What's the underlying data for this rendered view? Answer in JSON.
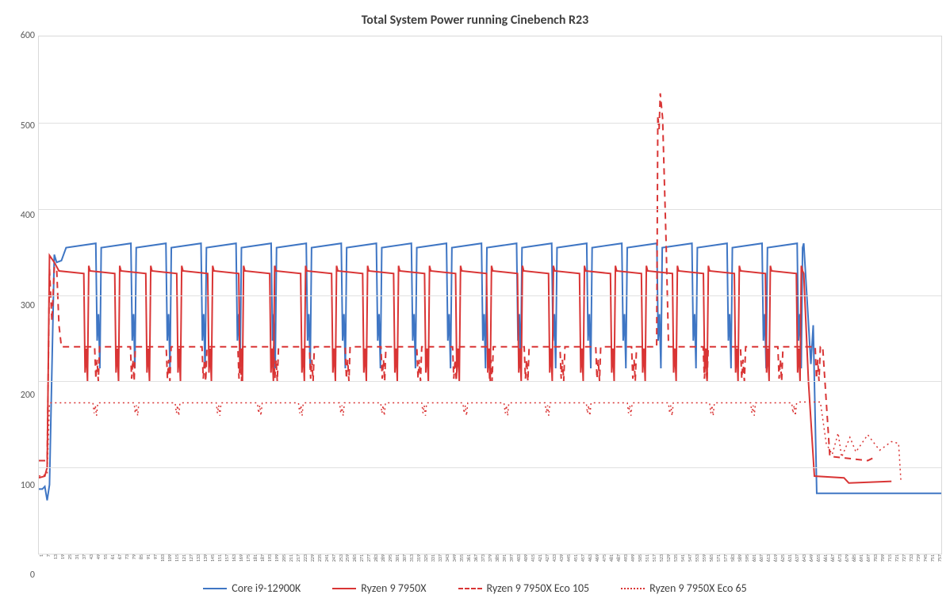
{
  "chart_data": {
    "type": "line",
    "title": "Total System Power running Cinebench R23",
    "xlabel": "",
    "ylabel": "",
    "ylim": [
      0,
      600
    ],
    "yticks": [
      0,
      100,
      200,
      300,
      400,
      500,
      600
    ],
    "x_range": [
      1,
      762
    ],
    "x_tick_step": 6,
    "series": [
      {
        "name": "Core i9-12900K",
        "color": "#3f76c4",
        "dash": "solid",
        "pattern": {
          "startup": [
            {
              "x": 1,
              "y": 75
            },
            {
              "x": 4,
              "y": 75
            },
            {
              "x": 6,
              "y": 78
            },
            {
              "x": 8,
              "y": 62
            },
            {
              "x": 10,
              "y": 80
            },
            {
              "x": 14,
              "y": 347
            },
            {
              "x": 16,
              "y": 338
            },
            {
              "x": 20,
              "y": 340
            }
          ],
          "cycle_start_x": 24,
          "cycle_end_x": 645,
          "cycle_count": 21,
          "cycle_shape": [
            {
              "dx": 0,
              "y": 355
            },
            {
              "dx": 22,
              "y": 360
            },
            {
              "dx": 23,
              "y": 247
            },
            {
              "dx": 24,
              "y": 278
            },
            {
              "dx": 25,
              "y": 215
            },
            {
              "dx": 26,
              "y": 355
            }
          ],
          "tail": [
            {
              "x": 646,
              "y": 360
            },
            {
              "x": 652,
              "y": 220
            },
            {
              "x": 654,
              "y": 265
            },
            {
              "x": 657,
              "y": 70
            },
            {
              "x": 762,
              "y": 70
            }
          ]
        }
      },
      {
        "name": "Ryzen 9 7950X",
        "color": "#d93535",
        "dash": "solid",
        "pattern": {
          "startup": [
            {
              "x": 1,
              "y": 88
            },
            {
              "x": 6,
              "y": 90
            },
            {
              "x": 8,
              "y": 100
            },
            {
              "x": 10,
              "y": 346
            },
            {
              "x": 14,
              "y": 338
            }
          ],
          "cycle_start_x": 18,
          "cycle_end_x": 645,
          "cycle_count": 24,
          "cycle_shape": [
            {
              "dx": 0,
              "y": 328
            },
            {
              "dx": 20,
              "y": 325
            },
            {
              "dx": 21,
              "y": 210
            },
            {
              "dx": 22,
              "y": 238
            },
            {
              "dx": 23,
              "y": 200
            },
            {
              "dx": 24,
              "y": 334
            },
            {
              "dx": 25,
              "y": 328
            }
          ],
          "tail": [
            {
              "x": 646,
              "y": 325
            },
            {
              "x": 650,
              "y": 200
            },
            {
              "x": 655,
              "y": 90
            },
            {
              "x": 680,
              "y": 88
            },
            {
              "x": 684,
              "y": 82
            },
            {
              "x": 720,
              "y": 84
            }
          ]
        }
      },
      {
        "name": "Ryzen 9 7950X Eco 105",
        "color": "#d93535",
        "dash": "dashed",
        "pattern": {
          "startup": [
            {
              "x": 1,
              "y": 108
            },
            {
              "x": 8,
              "y": 108
            },
            {
              "x": 10,
              "y": 330
            },
            {
              "x": 12,
              "y": 270
            },
            {
              "x": 14,
              "y": 332
            },
            {
              "x": 16,
              "y": 332
            },
            {
              "x": 18,
              "y": 265
            },
            {
              "x": 20,
              "y": 240
            }
          ],
          "cycle_start_x": 22,
          "cycle_end_x": 505,
          "cycle_count": 16,
          "cycle_shape": [
            {
              "dx": 0,
              "y": 240
            },
            {
              "dx": 25,
              "y": 240
            },
            {
              "dx": 26,
              "y": 203
            },
            {
              "dx": 27,
              "y": 225
            },
            {
              "dx": 28,
              "y": 200
            },
            {
              "dx": 29,
              "y": 240
            }
          ],
          "spike": [
            {
              "x": 508,
              "y": 240
            },
            {
              "x": 522,
              "y": 240
            },
            {
              "x": 523,
              "y": 508
            },
            {
              "x": 524,
              "y": 492
            },
            {
              "x": 525,
              "y": 534
            },
            {
              "x": 527,
              "y": 505
            },
            {
              "x": 530,
              "y": 360
            },
            {
              "x": 532,
              "y": 240
            }
          ],
          "post_spike_cycle_start_x": 534,
          "post_spike_cycle_end_x": 660,
          "post_spike_cycle_count": 4,
          "tail": [
            {
              "x": 662,
              "y": 240
            },
            {
              "x": 668,
              "y": 113
            },
            {
              "x": 700,
              "y": 108
            },
            {
              "x": 706,
              "y": 112
            }
          ]
        }
      },
      {
        "name": "Ryzen 9 7950X Eco 65",
        "color": "#d93535",
        "dash": "dotted",
        "pattern": {
          "startup": [
            {
              "x": 1,
              "y": 90
            },
            {
              "x": 8,
              "y": 92
            },
            {
              "x": 10,
              "y": 175
            },
            {
              "x": 14,
              "y": 175
            }
          ],
          "cycle_start_x": 16,
          "cycle_end_x": 640,
          "cycle_count": 18,
          "cycle_shape": [
            {
              "dx": 0,
              "y": 175
            },
            {
              "dx": 30,
              "y": 175
            },
            {
              "dx": 31,
              "y": 163
            },
            {
              "dx": 32,
              "y": 172
            },
            {
              "dx": 33,
              "y": 160
            },
            {
              "dx": 34,
              "y": 175
            }
          ],
          "tail": [
            {
              "x": 642,
              "y": 176
            },
            {
              "x": 660,
              "y": 176
            },
            {
              "x": 665,
              "y": 128
            },
            {
              "x": 670,
              "y": 115
            },
            {
              "x": 675,
              "y": 140
            },
            {
              "x": 678,
              "y": 112
            },
            {
              "x": 685,
              "y": 135
            },
            {
              "x": 690,
              "y": 118
            },
            {
              "x": 700,
              "y": 138
            },
            {
              "x": 710,
              "y": 120
            },
            {
              "x": 720,
              "y": 130
            },
            {
              "x": 726,
              "y": 128
            },
            {
              "x": 728,
              "y": 84
            }
          ]
        }
      }
    ]
  },
  "legend": [
    {
      "label": "Core i9-12900K",
      "color": "#3f76c4",
      "dash": "solid"
    },
    {
      "label": "Ryzen 9 7950X",
      "color": "#d93535",
      "dash": "solid"
    },
    {
      "label": "Ryzen 9 7950X Eco 105",
      "color": "#d93535",
      "dash": "dashed"
    },
    {
      "label": "Ryzen 9 7950X Eco 65",
      "color": "#d93535",
      "dash": "dotted"
    }
  ]
}
